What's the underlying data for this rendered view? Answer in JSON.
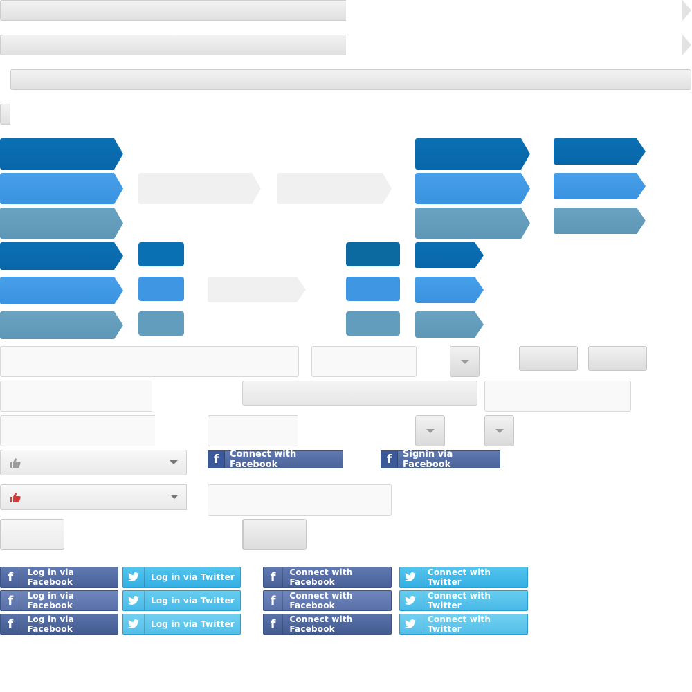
{
  "social": {
    "connect_facebook_large": "Connect with Facebook",
    "signin_facebook_large": "Signin via Facebook",
    "login_facebook": "Log in via Facebook",
    "login_twitter": "Log in via Twitter",
    "connect_facebook": "Connect with Facebook",
    "connect_twitter": "Connect with Twitter"
  },
  "icons": {
    "facebook": "f",
    "thumbs_up": "thumbs-up-icon",
    "twitter": "twitter-bird-icon"
  },
  "colors": {
    "ribbon_dark": "#0a70b4",
    "ribbon_mid": "#3f97e4",
    "ribbon_gray": "#639dbd",
    "facebook_blue": "#4a6198",
    "twitter_blue": "#36afe3",
    "thumb_gray": "#9b9b9b",
    "thumb_red": "#d9383a"
  }
}
